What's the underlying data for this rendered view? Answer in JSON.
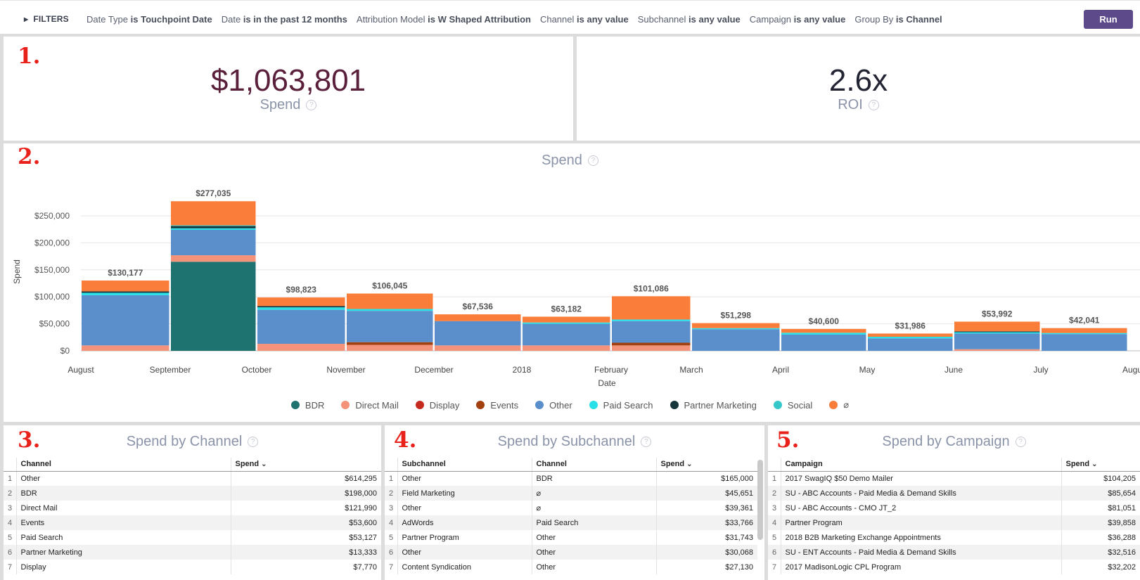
{
  "filters": {
    "toggle_label": "FILTERS",
    "items": [
      {
        "name": "Date Type",
        "op": "is",
        "value": "Touchpoint Date"
      },
      {
        "name": "Date",
        "op": "is in the past 12 months",
        "value": ""
      },
      {
        "name": "Attribution Model",
        "op": "is",
        "value": "W Shaped Attribution"
      },
      {
        "name": "Channel",
        "op": "is any value",
        "value": ""
      },
      {
        "name": "Subchannel",
        "op": "is any value",
        "value": ""
      },
      {
        "name": "Campaign",
        "op": "is any value",
        "value": ""
      },
      {
        "name": "Group By",
        "op": "is",
        "value": "Channel"
      }
    ],
    "run_label": "Run"
  },
  "annotations": [
    "1.",
    "2.",
    "3.",
    "4.",
    "5."
  ],
  "kpis": {
    "spend": {
      "value": "$1,063,801",
      "label": "Spend",
      "color": "#5a1f3a"
    },
    "roi": {
      "value": "2.6x",
      "label": "ROI",
      "color": "#222433"
    }
  },
  "help_glyph": "?",
  "chart_data": {
    "type": "bar",
    "title": "Spend",
    "xlabel": "Date",
    "ylabel": "Spend",
    "ylim": [
      0,
      280000
    ],
    "yticks": [
      "$0",
      "$50,000",
      "$100,000",
      "$150,000",
      "$200,000",
      "$250,000"
    ],
    "x_tick_labels": [
      "August",
      "September",
      "October",
      "November",
      "December",
      "2018",
      "February",
      "March",
      "April",
      "May",
      "June",
      "July",
      "August"
    ],
    "categories": [
      "Aug",
      "Sep",
      "Oct",
      "Nov",
      "Dec",
      "Jan",
      "Feb",
      "Mar",
      "Apr",
      "May",
      "Jun",
      "Jul"
    ],
    "totals": [
      130177,
      277035,
      98823,
      106045,
      67536,
      63182,
      101086,
      51298,
      40600,
      31986,
      53992,
      42041
    ],
    "total_labels": [
      "$130,177",
      "$277,035",
      "$98,823",
      "$106,045",
      "$67,536",
      "$63,182",
      "$101,086",
      "$51,298",
      "$40,600",
      "$31,986",
      "$53,992",
      "$42,041"
    ],
    "series": [
      {
        "name": "BDR",
        "color": "#1e7370",
        "values": [
          0,
          165000,
          0,
          0,
          0,
          0,
          0,
          0,
          0,
          0,
          0,
          0
        ]
      },
      {
        "name": "Direct Mail",
        "color": "#f4937a",
        "values": [
          10000,
          12000,
          13000,
          11000,
          10000,
          10000,
          10000,
          0,
          0,
          0,
          3000,
          0
        ]
      },
      {
        "name": "Display",
        "color": "#c52a1f",
        "values": [
          0,
          0,
          0,
          0,
          0,
          0,
          0,
          0,
          0,
          0,
          0,
          0
        ]
      },
      {
        "name": "Events",
        "color": "#a3400f",
        "values": [
          0,
          0,
          0,
          5000,
          0,
          0,
          5000,
          0,
          0,
          0,
          0,
          0
        ]
      },
      {
        "name": "Other",
        "color": "#5a8fcc",
        "values": [
          93000,
          47000,
          63000,
          58000,
          45000,
          40000,
          40000,
          40000,
          30000,
          23000,
          29000,
          31000
        ]
      },
      {
        "name": "Paid Search",
        "color": "#29e0e8",
        "values": [
          4500,
          3000,
          4500,
          3500,
          0,
          2500,
          3000,
          2000,
          3500,
          3000,
          2500,
          2000
        ]
      },
      {
        "name": "Partner Marketing",
        "color": "#15363a",
        "values": [
          2500,
          4000,
          2500,
          0,
          0,
          0,
          0,
          0,
          0,
          0,
          1500,
          0
        ]
      },
      {
        "name": "Social",
        "color": "#36c7c9",
        "values": [
          0,
          1500,
          0,
          0,
          0,
          0,
          0,
          0,
          0,
          0,
          0,
          0
        ]
      },
      {
        "name": "⌀",
        "color": "#fb7d3a",
        "values": [
          20177,
          44535,
          15823,
          28545,
          12536,
          10682,
          43086,
          9298,
          7100,
          5986,
          17992,
          9041
        ]
      }
    ]
  },
  "tables": {
    "channel": {
      "title": "Spend by Channel",
      "columns": [
        "Channel",
        "Spend"
      ],
      "rows": [
        [
          "1",
          "Other",
          "$614,295"
        ],
        [
          "2",
          "BDR",
          "$198,000"
        ],
        [
          "3",
          "Direct Mail",
          "$121,990"
        ],
        [
          "4",
          "Events",
          "$53,600"
        ],
        [
          "5",
          "Paid Search",
          "$53,127"
        ],
        [
          "6",
          "Partner Marketing",
          "$13,333"
        ],
        [
          "7",
          "Display",
          "$7,770"
        ]
      ]
    },
    "subchannel": {
      "title": "Spend by Subchannel",
      "columns": [
        "Subchannel",
        "Channel",
        "Spend"
      ],
      "rows": [
        [
          "1",
          "Other",
          "BDR",
          "$165,000"
        ],
        [
          "2",
          "Field Marketing",
          "⌀",
          "$45,651"
        ],
        [
          "3",
          "Other",
          "⌀",
          "$39,361"
        ],
        [
          "4",
          "AdWords",
          "Paid Search",
          "$33,766"
        ],
        [
          "5",
          "Partner Program",
          "Other",
          "$31,743"
        ],
        [
          "6",
          "Other",
          "Other",
          "$30,068"
        ],
        [
          "7",
          "Content Syndication",
          "Other",
          "$27,130"
        ]
      ]
    },
    "campaign": {
      "title": "Spend by Campaign",
      "columns": [
        "Campaign",
        "Spend"
      ],
      "rows": [
        [
          "1",
          "2017 SwagIQ $50 Demo Mailer",
          "$104,205"
        ],
        [
          "2",
          "SU - ABC Accounts - Paid Media & Demand Skills",
          "$85,654"
        ],
        [
          "3",
          "SU - ABC Accounts - CMO JT_2",
          "$81,051"
        ],
        [
          "4",
          "Partner Program",
          "$39,858"
        ],
        [
          "5",
          "2018 B2B Marketing Exchange Appointments",
          "$36,288"
        ],
        [
          "6",
          "SU - ENT Accounts - Paid Media & Demand Skills",
          "$32,516"
        ],
        [
          "7",
          "2017 MadisonLogic CPL Program",
          "$32,202"
        ]
      ]
    }
  }
}
